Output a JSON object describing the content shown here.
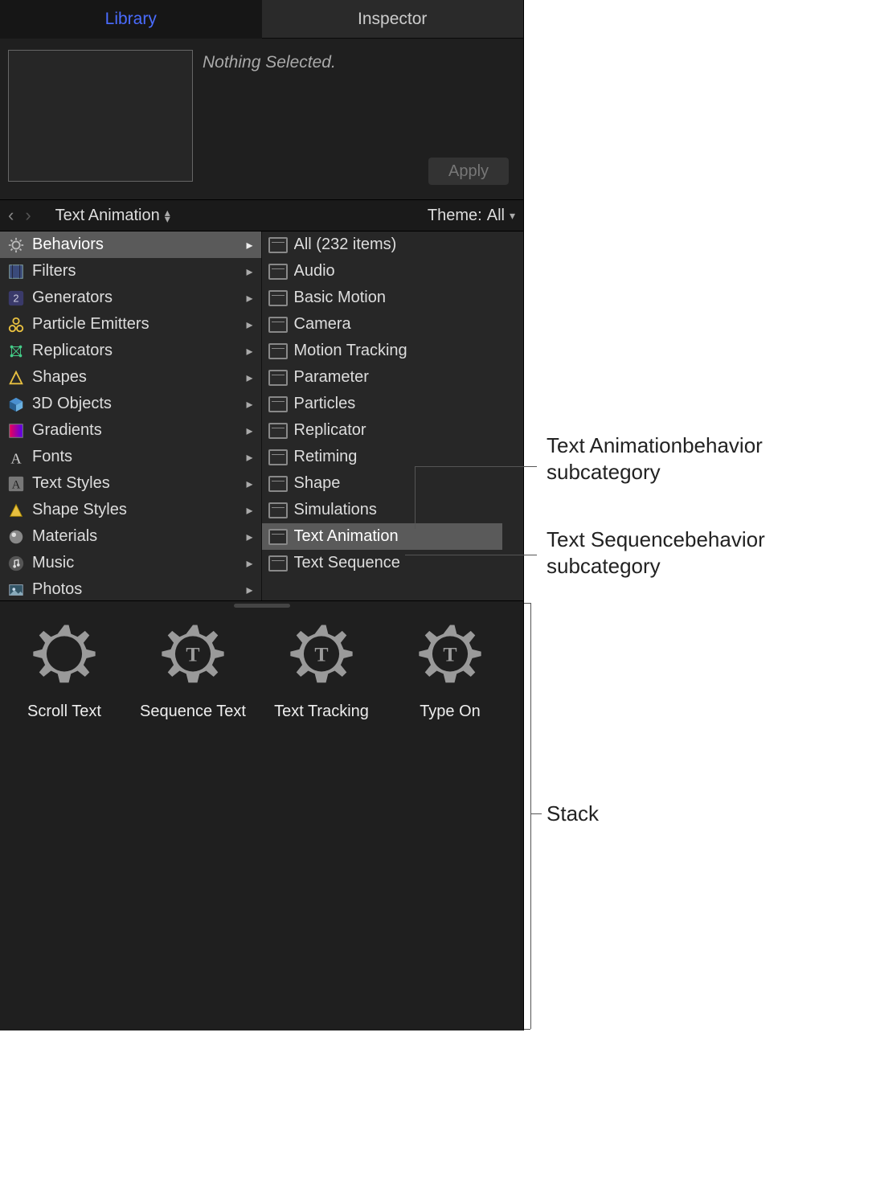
{
  "tabs": {
    "library": "Library",
    "inspector": "Inspector"
  },
  "preview": {
    "status": "Nothing Selected.",
    "apply": "Apply"
  },
  "pathbar": {
    "breadcrumb": "Text Animation",
    "theme_label": "Theme:",
    "theme_value": "All"
  },
  "categories": [
    {
      "label": "Behaviors",
      "icon": "gear",
      "selected": true
    },
    {
      "label": "Filters",
      "icon": "filmstrip"
    },
    {
      "label": "Generators",
      "icon": "generator"
    },
    {
      "label": "Particle Emitters",
      "icon": "emitter"
    },
    {
      "label": "Replicators",
      "icon": "replicator"
    },
    {
      "label": "Shapes",
      "icon": "shapes"
    },
    {
      "label": "3D Objects",
      "icon": "cube"
    },
    {
      "label": "Gradients",
      "icon": "gradient"
    },
    {
      "label": "Fonts",
      "icon": "font-a"
    },
    {
      "label": "Text Styles",
      "icon": "textstyle"
    },
    {
      "label": "Shape Styles",
      "icon": "shapestyle"
    },
    {
      "label": "Materials",
      "icon": "material"
    },
    {
      "label": "Music",
      "icon": "music"
    },
    {
      "label": "Photos",
      "icon": "photos"
    }
  ],
  "subcategories": [
    {
      "label": "All (232 items)"
    },
    {
      "label": "Audio"
    },
    {
      "label": "Basic Motion"
    },
    {
      "label": "Camera"
    },
    {
      "label": "Motion Tracking"
    },
    {
      "label": "Parameter"
    },
    {
      "label": "Particles"
    },
    {
      "label": "Replicator"
    },
    {
      "label": "Retiming"
    },
    {
      "label": "Shape"
    },
    {
      "label": "Simulations"
    },
    {
      "label": "Text Animation",
      "selected": true
    },
    {
      "label": "Text Sequence"
    }
  ],
  "stack": [
    {
      "label": "Scroll Text",
      "t": false
    },
    {
      "label": "Sequence Text",
      "t": true
    },
    {
      "label": "Text Tracking",
      "t": true
    },
    {
      "label": "Type On",
      "t": true
    }
  ],
  "annotations": {
    "a1": "Text Animation behavior subcategory",
    "a2": "Text Sequence behavior subcategory",
    "a3": "Stack"
  }
}
